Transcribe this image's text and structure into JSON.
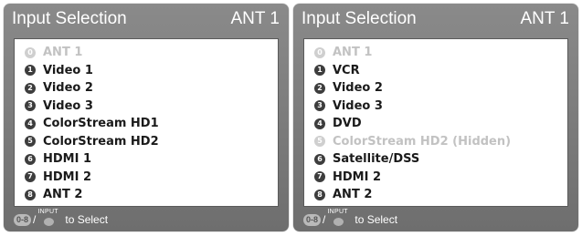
{
  "menus": [
    {
      "title": "Input Selection",
      "source": "ANT 1",
      "items": [
        {
          "num": "0",
          "label": "ANT 1",
          "disabled": true
        },
        {
          "num": "1",
          "label": "Video 1",
          "disabled": false
        },
        {
          "num": "2",
          "label": "Video 2",
          "disabled": false
        },
        {
          "num": "3",
          "label": "Video 3",
          "disabled": false
        },
        {
          "num": "4",
          "label": "ColorStream HD1",
          "disabled": false
        },
        {
          "num": "5",
          "label": "ColorStream HD2",
          "disabled": false
        },
        {
          "num": "6",
          "label": "HDMI 1",
          "disabled": false
        },
        {
          "num": "7",
          "label": "HDMI 2",
          "disabled": false
        },
        {
          "num": "8",
          "label": "ANT 2",
          "disabled": false
        }
      ],
      "footer": {
        "range_start": "0",
        "range_sep": "-",
        "range_end": "8",
        "slash": "/",
        "input_caption": "INPUT",
        "hint": "to Select"
      }
    },
    {
      "title": "Input Selection",
      "source": "ANT 1",
      "items": [
        {
          "num": "0",
          "label": "ANT 1",
          "disabled": true
        },
        {
          "num": "1",
          "label": "VCR",
          "disabled": false
        },
        {
          "num": "2",
          "label": "Video 2",
          "disabled": false
        },
        {
          "num": "3",
          "label": "Video 3",
          "disabled": false
        },
        {
          "num": "4",
          "label": "DVD",
          "disabled": false
        },
        {
          "num": "5",
          "label": "ColorStream HD2 (Hidden)",
          "disabled": true
        },
        {
          "num": "6",
          "label": "Satellite/DSS",
          "disabled": false
        },
        {
          "num": "7",
          "label": "HDMI 2",
          "disabled": false
        },
        {
          "num": "8",
          "label": "ANT 2",
          "disabled": false
        }
      ],
      "footer": {
        "range_start": "0",
        "range_sep": "-",
        "range_end": "8",
        "slash": "/",
        "input_caption": "INPUT",
        "hint": "to Select"
      }
    }
  ]
}
